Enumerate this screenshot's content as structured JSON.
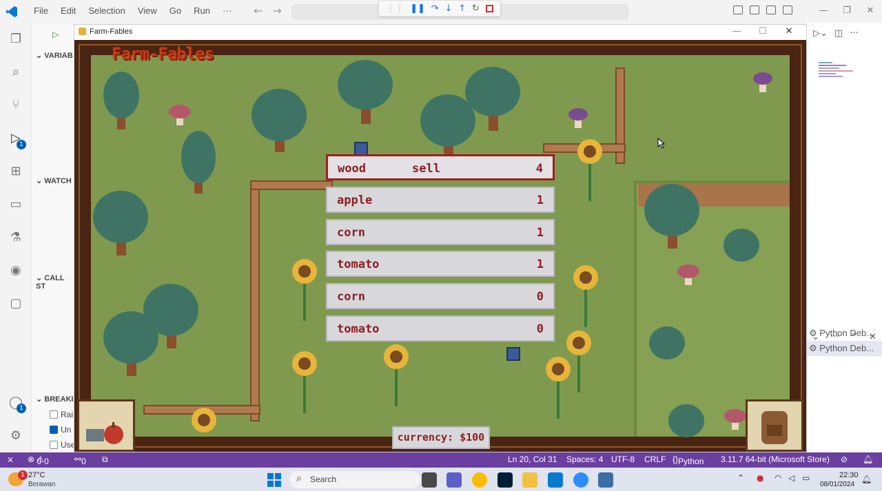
{
  "vscode": {
    "menu": [
      "File",
      "Edit",
      "Selection",
      "View",
      "Go",
      "Run",
      "···"
    ],
    "sidepanel": {
      "sections": [
        "VARIAB",
        "WATCH",
        "CALL ST",
        "BREAKI"
      ],
      "breakpoints": [
        {
          "label": "Rai",
          "checked": false
        },
        {
          "label": "Un",
          "checked": true
        },
        {
          "label": "Use",
          "checked": false
        }
      ]
    },
    "activity_badges": {
      "debug": "1",
      "account": "1"
    },
    "right_panel": {
      "items": [
        "Python Deb...",
        "Python Deb..."
      ]
    },
    "statusbar": {
      "errors": "0",
      "warnings": "0",
      "ports": "0",
      "position": "Ln 20, Col 31",
      "spaces": "Spaces: 4",
      "encoding": "UTF-8",
      "eol": "CRLF",
      "language": "Python",
      "interpreter": "3.11.7 64-bit (Microsoft Store)"
    },
    "accent": "#6b3fa0"
  },
  "game": {
    "window_title": "Farm-Fables",
    "logo": "Farm-Fables",
    "menu": [
      {
        "name": "wood",
        "action": "sell",
        "qty": "4",
        "selected": true
      },
      {
        "name": "apple",
        "action": "",
        "qty": "1",
        "selected": false
      },
      {
        "name": "corn",
        "action": "",
        "qty": "1",
        "selected": false
      },
      {
        "name": "tomato",
        "action": "",
        "qty": "1",
        "selected": false
      },
      {
        "name": "corn",
        "action": "",
        "qty": "0",
        "selected": false
      },
      {
        "name": "tomato",
        "action": "",
        "qty": "0",
        "selected": false
      }
    ],
    "currency": "currency: $100"
  },
  "taskbar": {
    "weather_temp": "27°C",
    "weather_desc": "Berawan",
    "weather_badge": "1",
    "search": "Search",
    "time": "22:30",
    "date": "08/01/2024"
  }
}
